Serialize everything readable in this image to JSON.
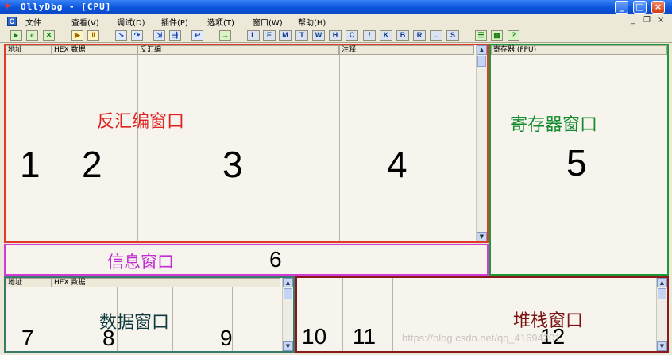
{
  "window": {
    "title": "OllyDbg - [CPU]",
    "app_icon": "bug-icon"
  },
  "menu": {
    "items": [
      "文件",
      "查看(V)",
      "调试(D)",
      "插件(P)",
      "选项(T)",
      "窗口(W)",
      "帮助(H)"
    ],
    "mdi_controls": [
      "_",
      "❐",
      "×"
    ]
  },
  "toolbar": {
    "letters": [
      "L",
      "E",
      "M",
      "T",
      "W",
      "H",
      "C",
      "/",
      "K",
      "B",
      "R",
      "...",
      "S"
    ]
  },
  "disasm": {
    "headers": [
      "地址",
      "HEX 数据",
      "反汇编",
      "注释"
    ],
    "label": "反汇编窗口",
    "numbers": [
      "1",
      "2",
      "3",
      "4"
    ]
  },
  "registers": {
    "header": "寄存器 (FPU)",
    "label": "寄存器窗口",
    "number": "5"
  },
  "info": {
    "label": "信息窗口",
    "number": "6"
  },
  "dump": {
    "headers": [
      "地址",
      "HEX 数据"
    ],
    "label": "数据窗口",
    "numbers": [
      "7",
      "8",
      "9"
    ]
  },
  "stack": {
    "label": "堆栈窗口",
    "numbers": [
      "10",
      "11",
      "12"
    ]
  },
  "watermark": "https://blog.csdn.net/qq_41694201",
  "colors": {
    "disasm_border": "#e03a2a",
    "registers_border": "#1c9a3a",
    "info_border": "#d23bd6",
    "dump_border": "#3a7a6a",
    "stack_border": "#8a1a1a"
  }
}
